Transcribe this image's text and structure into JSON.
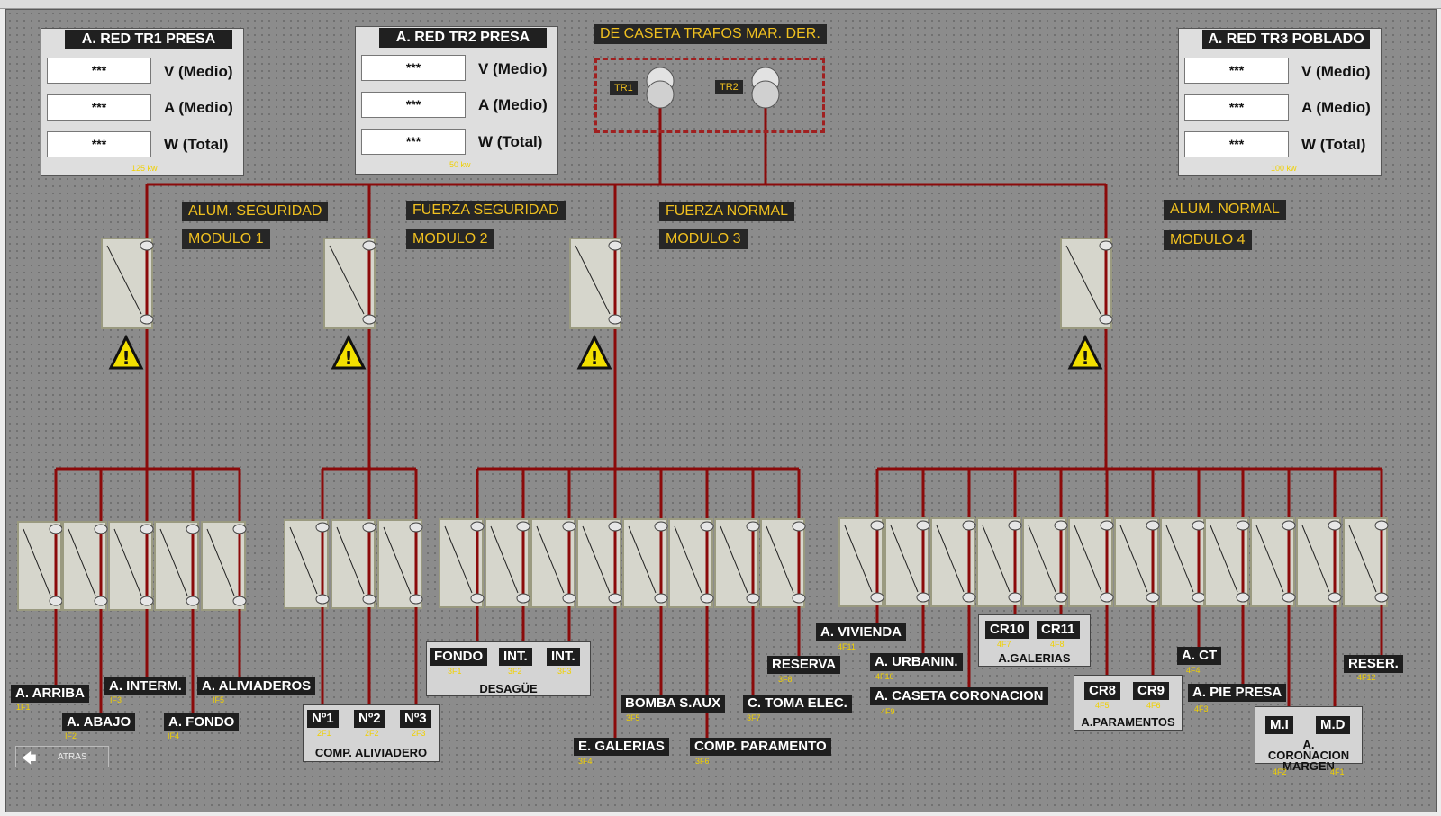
{
  "panels": [
    {
      "title": "A. RED TR1 PRESA",
      "v": "***",
      "a": "***",
      "w": "***",
      "v_unit": "V (Medio)",
      "a_unit": "A (Medio)",
      "w_unit": "W (Total)",
      "power": "125 kw"
    },
    {
      "title": "A. RED TR2 PRESA",
      "v": "***",
      "a": "***",
      "w": "***",
      "v_unit": "V (Medio)",
      "a_unit": "A (Medio)",
      "w_unit": "W (Total)",
      "power": "50 kw"
    },
    {
      "title": "A. RED TR3 POBLADO",
      "v": "***",
      "a": "***",
      "w": "***",
      "v_unit": "V (Medio)",
      "a_unit": "A (Medio)",
      "w_unit": "W (Total)",
      "power": "100 kw"
    }
  ],
  "transformers": {
    "title": "DE CASETA TRAFOS MAR. DER.",
    "tr1": "TR1",
    "tr2": "TR2"
  },
  "modules": [
    {
      "name": "ALUM. SEGURIDAD",
      "module": "MODULO 1"
    },
    {
      "name": "FUERZA SEGURIDAD",
      "module": "MODULO 2"
    },
    {
      "name": "FUERZA NORMAL",
      "module": "MODULO 3"
    },
    {
      "name": "ALUM. NORMAL",
      "module": "MODULO 4"
    }
  ],
  "feeders": {
    "m1": [
      {
        "label": "A. ARRIBA",
        "code": "1F1"
      },
      {
        "label": "A. ABAJO",
        "code": "IF2"
      },
      {
        "label": "A. INTERM.",
        "code": "IF3"
      },
      {
        "label": "A. FONDO",
        "code": "IF4"
      },
      {
        "label": "A. ALIVIADEROS",
        "code": "IF5"
      }
    ],
    "m2": [
      {
        "label": "Nº1",
        "code": "2F1"
      },
      {
        "label": "Nº2",
        "code": "2F2"
      },
      {
        "label": "Nº3",
        "code": "2F3"
      }
    ],
    "m2_group": "COMP. ALIVIADERO",
    "m3": [
      {
        "label": "FONDO",
        "code": "3F1"
      },
      {
        "label": "INT.",
        "code": "3F2"
      },
      {
        "label": "INT.",
        "code": "3F3"
      },
      {
        "label": "E. GALERIAS",
        "code": "3F4"
      },
      {
        "label": "BOMBA S.AUX",
        "code": "3F5"
      },
      {
        "label": "COMP. PARAMENTO",
        "code": "3F6"
      },
      {
        "label": "C. TOMA ELEC.",
        "code": "3F7"
      },
      {
        "label": "RESERVA",
        "code": "3F8"
      }
    ],
    "m3_group": "DESAGÜE",
    "m4": [
      {
        "label": "A. VIVIENDA",
        "code": "4F11"
      },
      {
        "label": "A. URBANIN.",
        "code": "4F10"
      },
      {
        "label": "A. CASETA CORONACION",
        "code": "4F9"
      },
      {
        "label": "CR10",
        "code": "4F7"
      },
      {
        "label": "CR11",
        "code": "4F8"
      },
      {
        "label": "CR8",
        "code": "4F5"
      },
      {
        "label": "CR9",
        "code": "4F6"
      },
      {
        "label": "A. CT",
        "code": "4F4"
      },
      {
        "label": "A. PIE PRESA",
        "code": "4F3"
      },
      {
        "label": "M.I",
        "code": "4F2"
      },
      {
        "label": "M.D",
        "code": "4F1"
      },
      {
        "label": "RESER.",
        "code": "4F12"
      }
    ],
    "galerias_group": "A.GALERIAS",
    "paramentos_group": "A.PARAMENTOS",
    "coronacion_group": "A. CORONACION MARGEN"
  },
  "nav": {
    "back": "ATRAS"
  },
  "colors": {
    "wire": "#8b0a0a",
    "label_bg": "#262626",
    "label_text": "#f0c020",
    "code_text": "#f0d000"
  }
}
